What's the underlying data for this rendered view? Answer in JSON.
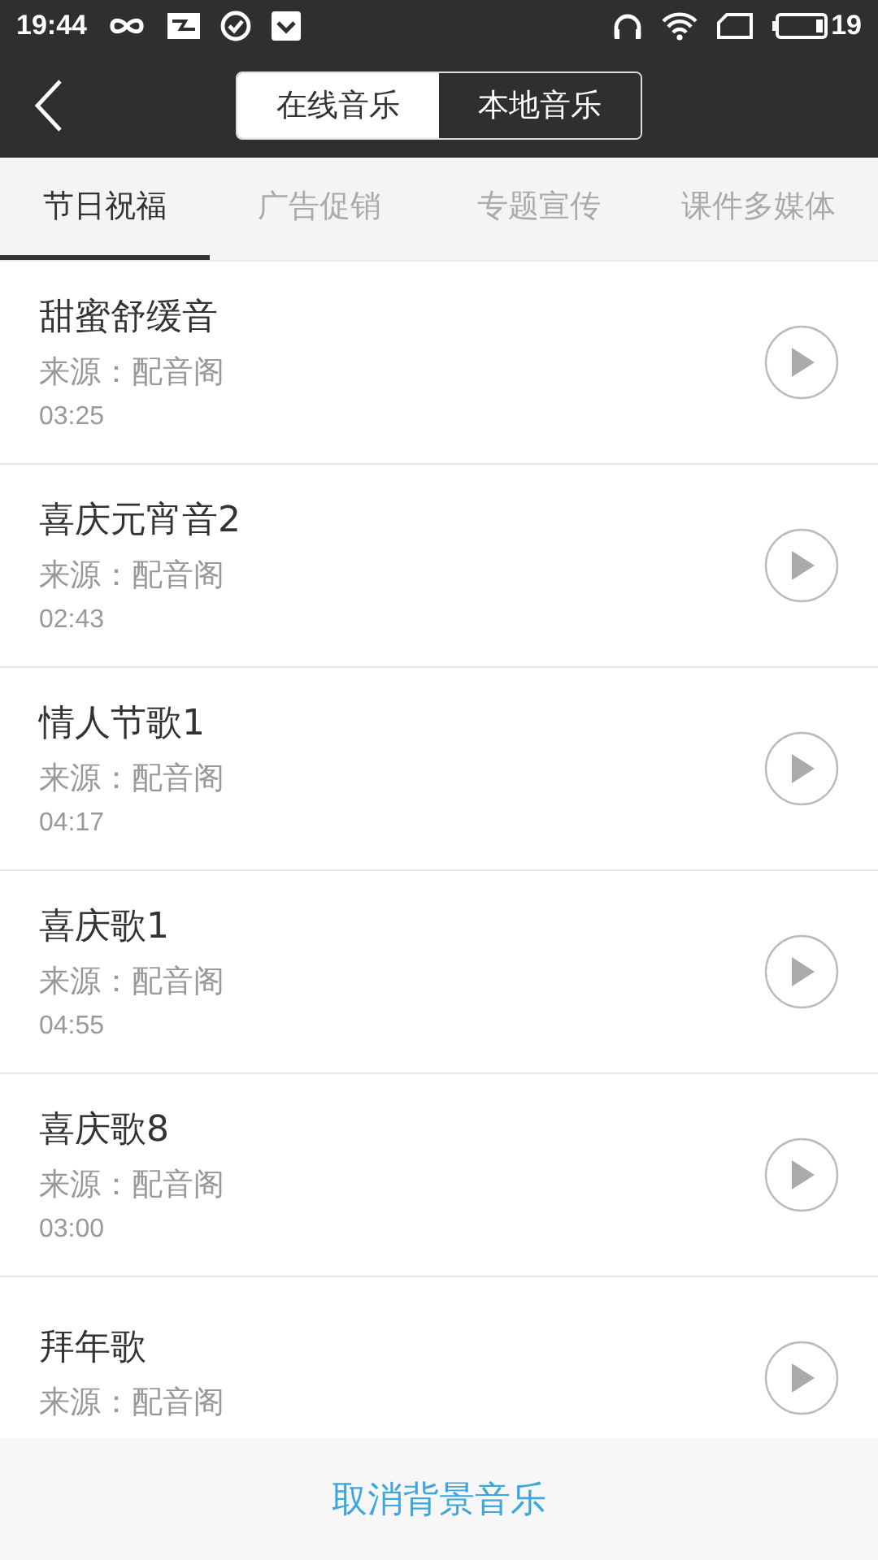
{
  "status_bar": {
    "time": "19:44",
    "battery": "19"
  },
  "header": {
    "segments": [
      {
        "label": "在线音乐",
        "selected": true
      },
      {
        "label": "本地音乐",
        "selected": false
      }
    ]
  },
  "tabs": [
    {
      "label": "节日祝福",
      "selected": true
    },
    {
      "label": "广告促销",
      "selected": false
    },
    {
      "label": "专题宣传",
      "selected": false
    },
    {
      "label": "课件多媒体",
      "selected": false
    }
  ],
  "tracks": [
    {
      "title": "甜蜜舒缓音",
      "source": "来源：配音阁",
      "duration": "03:25"
    },
    {
      "title": "喜庆元宵音2",
      "source": "来源：配音阁",
      "duration": "02:43"
    },
    {
      "title": "情人节歌1",
      "source": "来源：配音阁",
      "duration": "04:17"
    },
    {
      "title": "喜庆歌1",
      "source": "来源：配音阁",
      "duration": "04:55"
    },
    {
      "title": "喜庆歌8",
      "source": "来源：配音阁",
      "duration": "03:00"
    },
    {
      "title": "拜年歌",
      "source": "来源：配音阁"
    }
  ],
  "footer": {
    "button": "取消背景音乐"
  }
}
